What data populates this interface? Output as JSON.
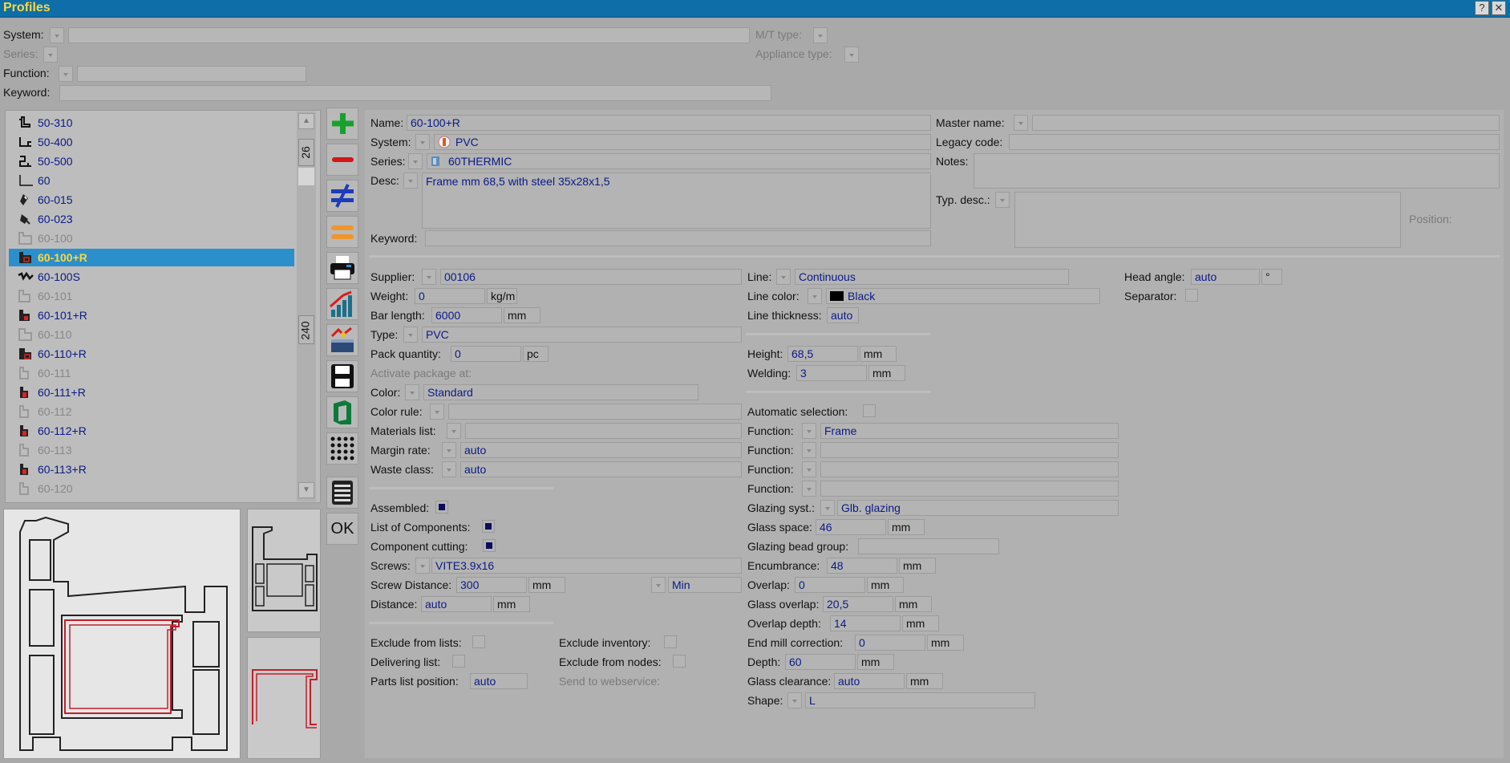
{
  "window": {
    "title": "Profiles",
    "help": "?",
    "close": "✕"
  },
  "filters": {
    "system": "System:",
    "mt_type": "M/T type:",
    "series": "Series:",
    "appliance_type": "Appliance type:",
    "function": "Function:",
    "keyword": "Keyword:"
  },
  "list": {
    "count_top": "26",
    "count_bottom": "240",
    "items": [
      {
        "label": "50-310"
      },
      {
        "label": "50-400"
      },
      {
        "label": "50-500"
      },
      {
        "label": "60"
      },
      {
        "label": "60-015"
      },
      {
        "label": "60-023"
      },
      {
        "label": "60-100"
      },
      {
        "label": "60-100+R"
      },
      {
        "label": "60-100S"
      },
      {
        "label": "60-101"
      },
      {
        "label": "60-101+R"
      },
      {
        "label": "60-110"
      },
      {
        "label": "60-110+R"
      },
      {
        "label": "60-111"
      },
      {
        "label": "60-111+R"
      },
      {
        "label": "60-112"
      },
      {
        "label": "60-112+R"
      },
      {
        "label": "60-113"
      },
      {
        "label": "60-113+R"
      },
      {
        "label": "60-120"
      }
    ]
  },
  "toolbar": {
    "ok": "OK"
  },
  "detail": {
    "name_lbl": "Name:",
    "name": "60-100+R",
    "system_lbl": "System:",
    "system": "PVC",
    "series_lbl": "Series:",
    "series": "60THERMIC",
    "desc_lbl": "Desc:",
    "desc": "Frame mm 68,5 with steel 35x28x1,5",
    "keyword_lbl": "Keyword:",
    "master_lbl": "Master name:",
    "legacy_lbl": "Legacy code:",
    "notes_lbl": "Notes:",
    "typdesc_lbl": "Typ. desc.:",
    "position_lbl": "Position:",
    "supplier_lbl": "Supplier:",
    "supplier": "00106",
    "weight_lbl": "Weight:",
    "weight": "0",
    "weight_unit": "kg/m",
    "barlen_lbl": "Bar length:",
    "barlen": "6000",
    "mm": "mm",
    "type_lbl": "Type:",
    "type": "PVC",
    "pack_lbl": "Pack quantity:",
    "pack": "0",
    "pack_unit": "pc",
    "activate_lbl": "Activate package at:",
    "color_lbl": "Color:",
    "color": "Standard",
    "colorrule_lbl": "Color rule:",
    "matlist_lbl": "Materials list:",
    "margin_lbl": "Margin rate:",
    "margin": "auto",
    "waste_lbl": "Waste class:",
    "waste": "auto",
    "assembled_lbl": "Assembled:",
    "components_lbl": "List of Components:",
    "compcut_lbl": "Component cutting:",
    "screws_lbl": "Screws:",
    "screws": "VITE3.9x16",
    "screwdist_lbl": "Screw Distance:",
    "screwdist": "300",
    "min": "Min",
    "distance_lbl": "Distance:",
    "distance": "auto",
    "exclists_lbl": "Exclude from lists:",
    "delivering_lbl": "Delivering list:",
    "partspos_lbl": "Parts list position:",
    "partspos": "auto",
    "excinv_lbl": "Exclude inventory:",
    "excnodes_lbl": "Exclude from nodes:",
    "webservice_lbl": "Send to webservice:",
    "line_lbl": "Line:",
    "line": "Continuous",
    "linecolor_lbl": "Line color:",
    "linecolor": "Black",
    "linethick_lbl": "Line thickness:",
    "linethick": "auto",
    "height_lbl": "Height:",
    "height": "68,5",
    "welding_lbl": "Welding:",
    "welding": "3",
    "autosel_lbl": "Automatic selection:",
    "function_lbl": "Function:",
    "function1": "Frame",
    "glazing_lbl": "Glazing syst.:",
    "glazing": "Glb. glazing",
    "glassspace_lbl": "Glass space:",
    "glassspace": "46",
    "beadgroup_lbl": "Glazing bead group:",
    "encumb_lbl": "Encumbrance:",
    "encumb": "48",
    "overlap_lbl": "Overlap:",
    "overlap": "0",
    "glassoverlap_lbl": "Glass overlap:",
    "glassoverlap": "20,5",
    "overlapdepth_lbl": "Overlap depth:",
    "overlapdepth": "14",
    "endmill_lbl": "End mill correction:",
    "endmill": "0",
    "depth_lbl": "Depth:",
    "depth": "60",
    "glassclear_lbl": "Glass clearance:",
    "glassclear": "auto",
    "shape_lbl": "Shape:",
    "shape": "L",
    "headangle_lbl": "Head angle:",
    "headangle": "auto",
    "deg": "°",
    "separator_lbl": "Separator:"
  },
  "colors": {
    "titlebar": "#0d6ea8",
    "title_text": "#ffd83b",
    "selection": "#2b8fcc",
    "value_text": "#0b1a86"
  }
}
